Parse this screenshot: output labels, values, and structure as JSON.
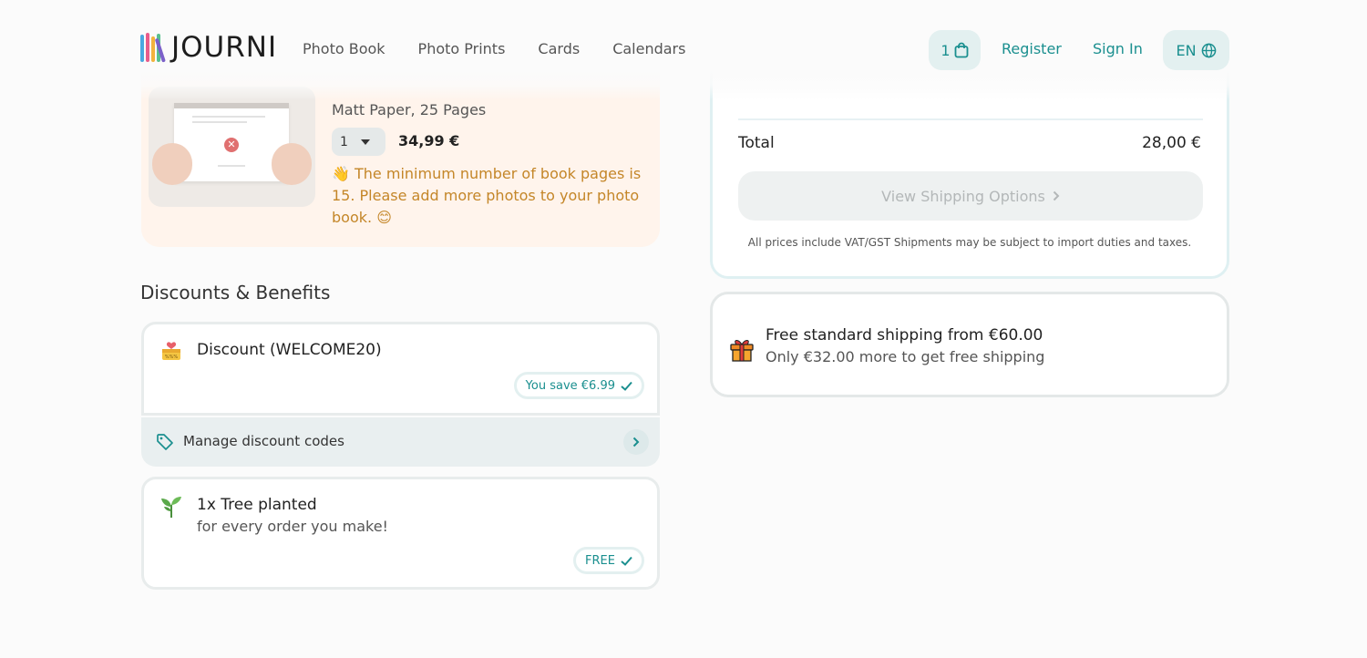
{
  "header": {
    "logo_text": "JOURNI",
    "logo_colors": [
      "#4aa8e0",
      "#e85c8b",
      "#f2b33d",
      "#59c08f",
      "#7b61c9"
    ],
    "nav": [
      "Photo Book",
      "Photo Prints",
      "Cards",
      "Calendars"
    ],
    "cart_count": "1",
    "register_label": "Register",
    "signin_label": "Sign In",
    "language": "EN",
    "accent_color": "#1a8f8f"
  },
  "product": {
    "subtitle": "Matt Paper, 25 Pages",
    "quantity": "1",
    "price": "34,99 €",
    "warning_emoji": "👋",
    "warning_text": "The minimum number of book pages is 15. Please add more photos to your photo book.",
    "warning_end_emoji": "😊"
  },
  "discounts": {
    "section_title": "Discounts & Benefits",
    "discount_title": "Discount (WELCOME20)",
    "discount_badge": "You save €6.99",
    "manage_label": "Manage discount codes",
    "tree_title": "1x Tree planted",
    "tree_sub": "for every order you make!",
    "tree_badge": "FREE"
  },
  "summary": {
    "total_label": "Total",
    "total_value": "28,00 €",
    "shipping_button": "View Shipping Options",
    "fineprint": "All prices include VAT/GST Shipments may be subject to import duties and taxes."
  },
  "shipping_promo": {
    "title": "Free standard shipping from €60.00",
    "subtitle": "Only €32.00 more to get free shipping"
  }
}
